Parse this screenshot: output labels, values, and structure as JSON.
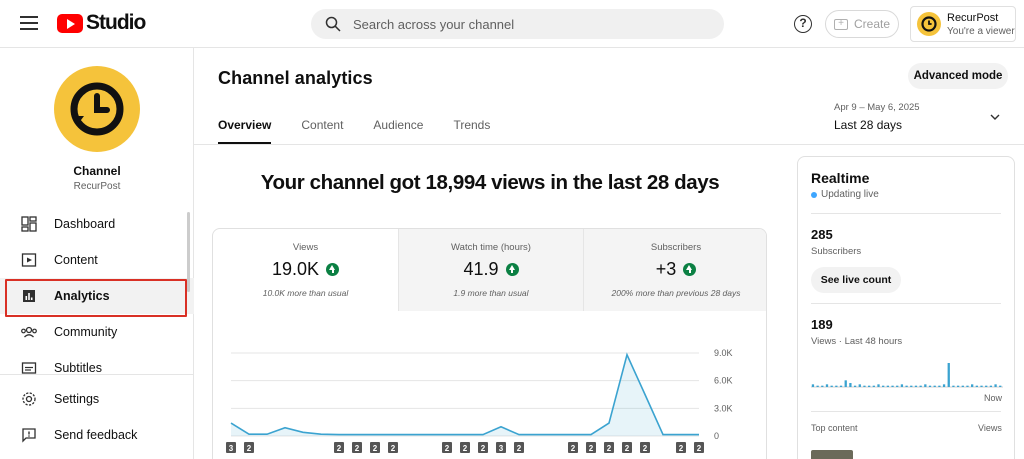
{
  "app": {
    "logo_text": "Studio",
    "search_placeholder": "Search across your channel",
    "create_label": "Create",
    "account": {
      "name": "RecurPost",
      "role": "You're a viewer"
    }
  },
  "sidebar": {
    "channel_title": "Channel",
    "channel_name": "RecurPost",
    "items": [
      {
        "label": "Dashboard",
        "icon": "dashboard-icon"
      },
      {
        "label": "Content",
        "icon": "content-icon"
      },
      {
        "label": "Analytics",
        "icon": "analytics-icon",
        "active": true
      },
      {
        "label": "Community",
        "icon": "community-icon"
      },
      {
        "label": "Subtitles",
        "icon": "subtitles-icon"
      }
    ],
    "footer": [
      {
        "label": "Settings",
        "icon": "gear-icon"
      },
      {
        "label": "Send feedback",
        "icon": "feedback-icon"
      }
    ]
  },
  "main": {
    "title": "Channel analytics",
    "advanced_mode": "Advanced mode",
    "tabs": [
      {
        "label": "Overview",
        "active": true
      },
      {
        "label": "Content"
      },
      {
        "label": "Audience"
      },
      {
        "label": "Trends"
      }
    ],
    "date_range": {
      "dates": "Apr 9 – May 6, 2025",
      "label": "Last 28 days"
    },
    "headline": "Your channel got 18,994 views in the last 28 days",
    "stats": [
      {
        "label": "Views",
        "value": "19.0K",
        "note": "10.0K more than usual",
        "trend": "up"
      },
      {
        "label": "Watch time (hours)",
        "value": "41.9",
        "note": "1.9 more than usual",
        "trend": "up"
      },
      {
        "label": "Subscribers",
        "value": "+3",
        "note": "200% more than previous 28 days",
        "trend": "up"
      }
    ]
  },
  "chart_data": {
    "type": "area",
    "y_ticks": [
      "9.0K",
      "6.0K",
      "3.0K",
      "0"
    ],
    "ylim": [
      0,
      9000
    ],
    "values": [
      1400,
      200,
      200,
      900,
      400,
      200,
      150,
      150,
      150,
      150,
      150,
      150,
      150,
      150,
      150,
      1000,
      150,
      150,
      150,
      150,
      150,
      1400,
      8800,
      4500,
      150,
      150,
      150
    ],
    "markers": [
      "3",
      "2",
      "",
      "",
      "",
      "",
      "2",
      "2",
      "2",
      "2",
      "",
      "",
      "2",
      "2",
      "2",
      "3",
      "2",
      "",
      "",
      "2",
      "2",
      "2",
      "2",
      "2",
      "",
      "2",
      "2"
    ],
    "color": "#3ba3d0"
  },
  "realtime": {
    "title": "Realtime",
    "status": "Updating live",
    "subscribers_count": "285",
    "subscribers_label": "Subscribers",
    "live_count_button": "See live count",
    "views_count": "189",
    "views_label": "Views · Last 48 hours",
    "now_label": "Now",
    "top_content_label": "Top content",
    "views_col_label": "Views",
    "bars": [
      2,
      1,
      1,
      2,
      1,
      1,
      1,
      5,
      3,
      1,
      2,
      1,
      1,
      1,
      2,
      1,
      1,
      1,
      1,
      2,
      1,
      1,
      1,
      1,
      2,
      1,
      1,
      1,
      2,
      18,
      1,
      1,
      1,
      1,
      2,
      1,
      1,
      1,
      1,
      2,
      1
    ],
    "accent": "#3ba3d0"
  }
}
